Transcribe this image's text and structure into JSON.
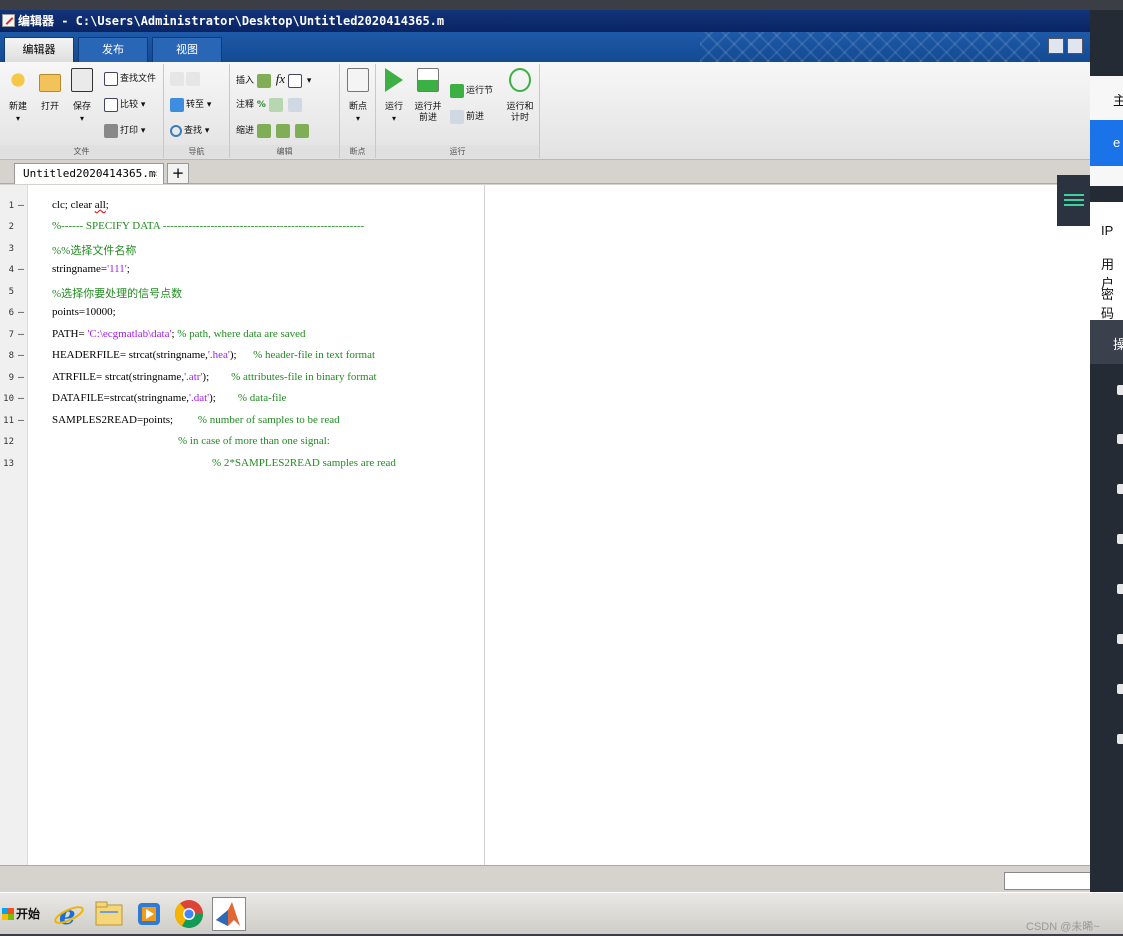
{
  "window": {
    "title": "编辑器 - C:\\Users\\Administrator\\Desktop\\Untitled2020414365.m"
  },
  "ribbon_tabs": [
    "编辑器",
    "发布",
    "视图"
  ],
  "ribbon": {
    "file": {
      "new_label": "新建",
      "open_label": "打开",
      "save_label": "保存",
      "find_files_label": "查找文件",
      "compare_label": "比较",
      "print_label": "打印",
      "group_label": "文件"
    },
    "navigate": {
      "goto_label": "转至",
      "find_label": "查找",
      "group_label": "导航"
    },
    "edit": {
      "insert_label": "插入",
      "fx_label": "fx",
      "comment_label": "注释",
      "indent_label": "缩进",
      "group_label": "编辑"
    },
    "breakpoints": {
      "label": "断点",
      "group_label": "断点"
    },
    "run": {
      "run_label": "运行",
      "run_advance_label": "运行并\n前进",
      "run_section_label": "运行节",
      "advance_label": "前进",
      "run_time_label": "运行和\n计时",
      "group_label": "运行"
    }
  },
  "doc_tab": {
    "name": "Untitled2020414365.m",
    "close": "×",
    "add": "+"
  },
  "code_lines": [
    {
      "n": "1",
      "dash": "–"
    },
    {
      "n": "2",
      "dash": ""
    },
    {
      "n": "3",
      "dash": ""
    },
    {
      "n": "4",
      "dash": "–"
    },
    {
      "n": "5",
      "dash": ""
    },
    {
      "n": "6",
      "dash": "–"
    },
    {
      "n": "7",
      "dash": "–"
    },
    {
      "n": "8",
      "dash": "–"
    },
    {
      "n": "9",
      "dash": "–"
    },
    {
      "n": "10",
      "dash": "–"
    },
    {
      "n": "11",
      "dash": "–"
    },
    {
      "n": "12",
      "dash": ""
    },
    {
      "n": "13",
      "dash": ""
    }
  ],
  "code": {
    "l1a": "clc; clear ",
    "l1b": "all",
    "l1c": ";",
    "l2": "%------ SPECIFY DATA -------------------------------------------------------",
    "l3": "%%选择文件名称",
    "l4a": "stringname=",
    "l4b": "'111'",
    "l4c": ";",
    "l5": "%选择你要处理的信号点数",
    "l6": "points=10000;",
    "l7a": "PATH= ",
    "l7b": "'C:\\ecgmatlab\\data'",
    "l7c": "; ",
    "l7d": "% path, where data are saved",
    "l8a": "HEADERFILE= strcat(stringname,",
    "l8b": "'.hea'",
    "l8c": ");      ",
    "l8d": "% header-file in text format",
    "l9a": "ATRFILE= strcat(stringname,",
    "l9b": "'.atr'",
    "l9c": ");        ",
    "l9d": "% attributes-file in binary format",
    "l10a": "DATAFILE=strcat(stringname,",
    "l10b": "'.dat'",
    "l10c": ");        ",
    "l10d": "% data-file",
    "l11a": "SAMPLES2READ=points;         ",
    "l11b": "% number of samples to be read",
    "l12": "% in case of more than one signal:",
    "l13": "% 2*SAMPLES2READ samples are read"
  },
  "side_panel": {
    "item1": "主",
    "item2": "e",
    "ip": "IP",
    "user": "用户",
    "pass": "密码",
    "op": "操"
  },
  "taskbar": {
    "start_label": "开始",
    "watermark": "CSDN @未晞~"
  },
  "colors": {
    "title_bg": "#0a2462",
    "ribbon_tab_bg": "#1e5aa8",
    "string": "#a020f0",
    "comment": "#228b22",
    "side_bg": "#252b35",
    "side_accent": "#1a73e8"
  }
}
